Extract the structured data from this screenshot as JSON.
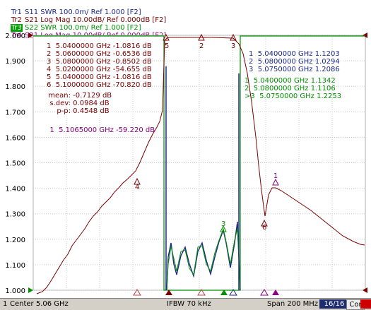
{
  "traces": [
    {
      "name": "Tr1",
      "param": "S11",
      "fmt": "SWR 100.0m/ Ref 1.000 [F2]",
      "color": "#1b2a8a",
      "active": false
    },
    {
      "name": "Tr2",
      "param": "S21",
      "fmt": "Log Mag 10.00dB/ Ref 0.000dB [F2]",
      "color": "#7a0000",
      "active": false
    },
    {
      "name": "Tr3",
      "param": "S22",
      "fmt": "SWR 100.0m/ Ref 1.000 [F2]",
      "color": "#009000",
      "active": true
    },
    {
      "name": "Tr4",
      "param": "S21",
      "fmt": "Log Mag 10.00dB/ Ref 0.000dB [F2]",
      "color": "#8a0080",
      "active": false
    }
  ],
  "y_axis": {
    "ticks": [
      "2.000",
      "1.900",
      "1.800",
      "1.700",
      "1.600",
      "1.500",
      "1.400",
      "1.300",
      "1.200",
      "1.100",
      "1.000"
    ],
    "min": 1.0,
    "max": 2.0
  },
  "marker_table_tr2": {
    "rows": [
      {
        "num": "1",
        "freq": "5.0400000",
        "unit": "GHz",
        "value": "-1.0816 dB"
      },
      {
        "num": "2",
        "freq": "5.0600000",
        "unit": "GHz",
        "value": "-0.6536 dB"
      },
      {
        "num": "3",
        "freq": "5.0800000",
        "unit": "GHz",
        "value": "-0.8502 dB"
      },
      {
        "num": "4",
        "freq": "5.0200000",
        "unit": "GHz",
        "value": "-54.655 dB"
      },
      {
        "num": "5",
        "freq": "5.0400000",
        "unit": "GHz",
        "value": "-1.0816 dB"
      },
      {
        "num": "6",
        "freq": "5.1000000",
        "unit": "GHz",
        "value": "-70.820 dB"
      }
    ],
    "stats": [
      {
        "label": "mean:",
        "value": "-0.7129 dB"
      },
      {
        "label": "s.dev:",
        "value": "0.0984 dB"
      },
      {
        "label": "p-p:",
        "value": "0.4548 dB"
      }
    ]
  },
  "marker_table_tr4": {
    "num": "1",
    "freq": "5.1065000",
    "unit": "GHz",
    "value": "-59.220 dB"
  },
  "marker_table_tr1": [
    {
      "num": "1",
      "freq": "5.0400000",
      "unit": "GHz",
      "value": "1.1203"
    },
    {
      "num": "2",
      "freq": "5.0800000",
      "unit": "GHz",
      "value": "1.0294"
    },
    {
      "num": "3",
      "freq": "5.0750000",
      "unit": "GHz",
      "value": "1.2086"
    }
  ],
  "marker_table_tr3": [
    {
      "num": "1",
      "freq": "5.0400000",
      "unit": "GHz",
      "value": "1.1342"
    },
    {
      "num": "2",
      "freq": "5.0800000",
      "unit": "GHz",
      "value": "1.1106"
    },
    {
      "num": ">3",
      "freq": "5.0750000",
      "unit": "GHz",
      "value": "1.2253"
    }
  ],
  "plot_marker_labels": {
    "m1": "1",
    "m2": "2",
    "m3": "3",
    "m4": "4",
    "m5": "5",
    "m6": "6"
  },
  "status": {
    "channel": "1",
    "start": "Center 5.06 GHz",
    "ifbw": "IFBW 70 kHz",
    "span": "Span 200 MHz",
    "sweep": "16/16",
    "cor": "Cor"
  },
  "colors": {
    "tr1": "#1b2a8a",
    "tr2": "#7a0000",
    "tr3": "#009000",
    "tr4": "#8a0080",
    "grid": "#c8c8c8"
  }
}
